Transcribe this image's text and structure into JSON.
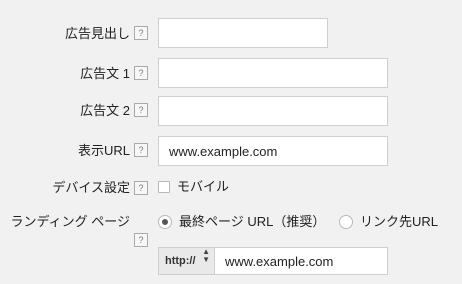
{
  "form": {
    "headline": {
      "label": "広告見出し",
      "value": ""
    },
    "desc1": {
      "label": "広告文 1",
      "value": ""
    },
    "desc2": {
      "label": "広告文 2",
      "value": ""
    },
    "display_url": {
      "label": "表示URL",
      "value": "www.example.com"
    },
    "device": {
      "label": "デバイス設定",
      "option": "モバイル",
      "checked": false
    },
    "landing": {
      "label": "ランディング ページ",
      "option_final": "最終ページ URL（推奨）",
      "option_link": "リンク先URL",
      "selected": "final",
      "protocol": "http://",
      "url": "www.example.com"
    },
    "help_glyph": "?"
  }
}
